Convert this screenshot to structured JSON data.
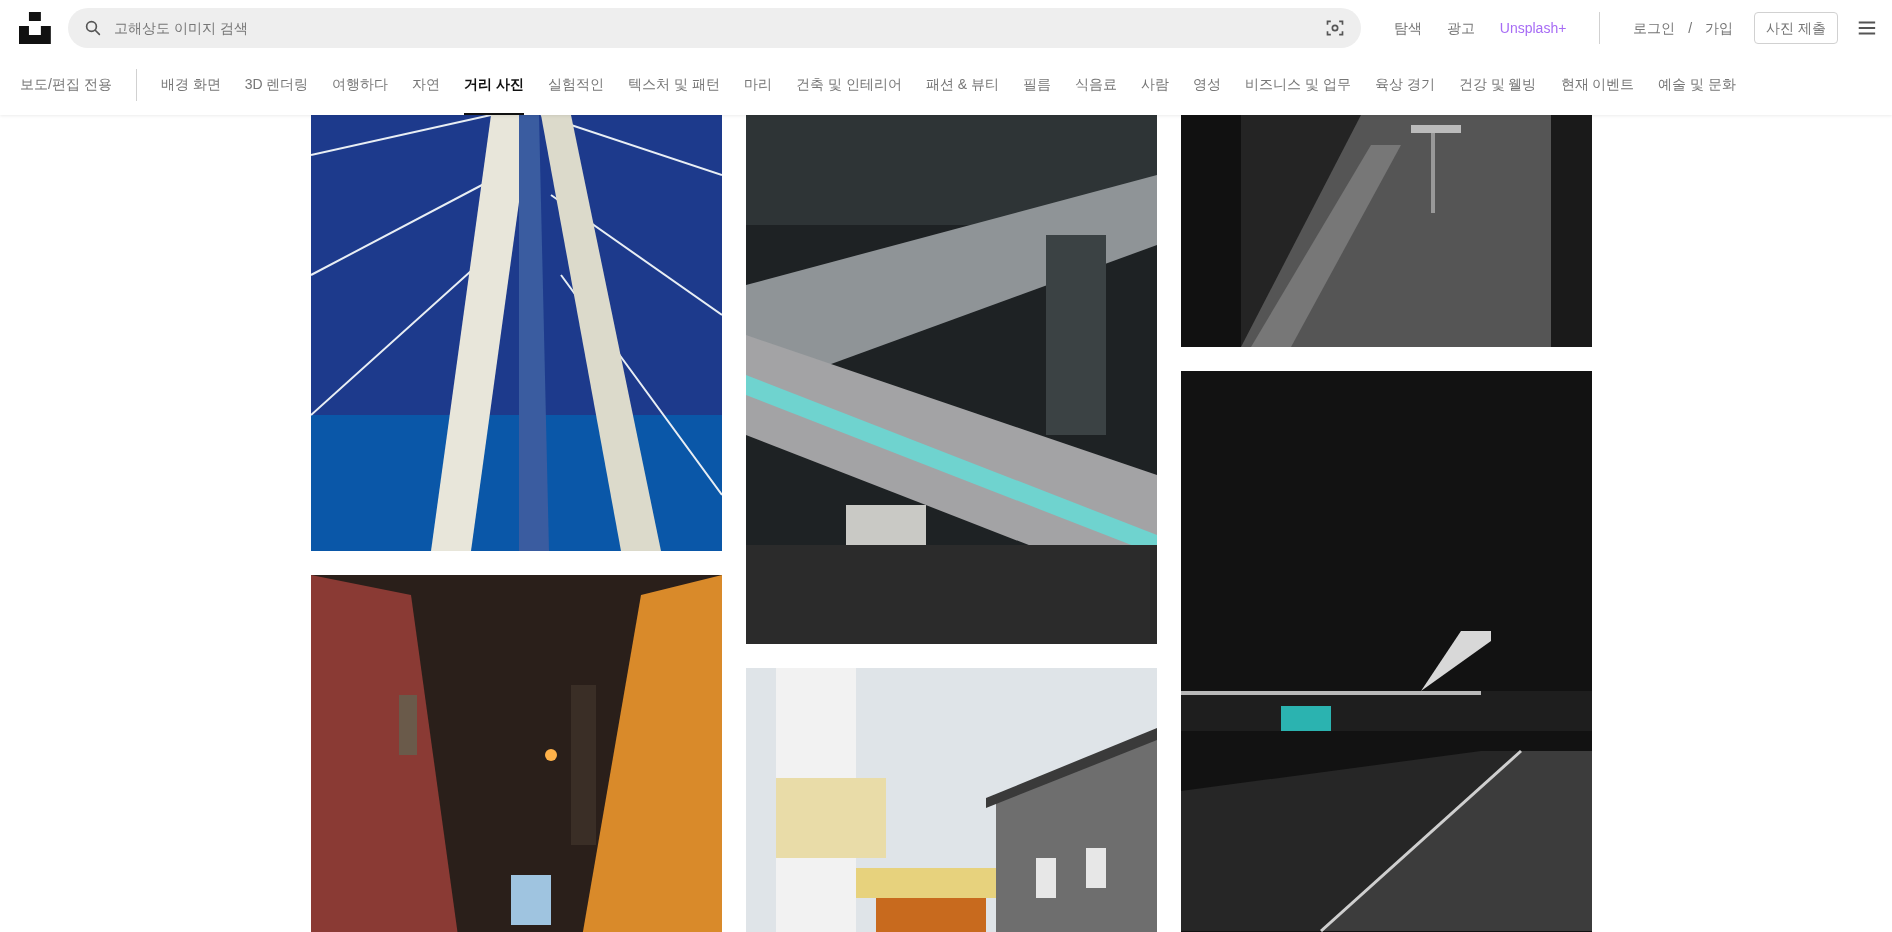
{
  "search": {
    "placeholder": "고해상도 이미지 검색"
  },
  "header_links": [
    {
      "label": "탐색",
      "kind": "plain"
    },
    {
      "label": "광고",
      "kind": "plain"
    },
    {
      "label": "Unsplash+",
      "kind": "accent"
    }
  ],
  "auth": {
    "login": "로그인",
    "separator": "/",
    "signup": "가입"
  },
  "submit_button": "사진 제출",
  "editorial_tab": {
    "label": "보도/편집 전용",
    "selected": false
  },
  "topics": [
    {
      "label": "배경 화면",
      "selected": false
    },
    {
      "label": "3D 렌더링",
      "selected": false
    },
    {
      "label": "여행하다",
      "selected": false
    },
    {
      "label": "자연",
      "selected": false
    },
    {
      "label": "거리 사진",
      "selected": true
    },
    {
      "label": "실험적인",
      "selected": false
    },
    {
      "label": "텍스처 및 패턴",
      "selected": false
    },
    {
      "label": "마리",
      "selected": false
    },
    {
      "label": "건축 및 인테리어",
      "selected": false
    },
    {
      "label": "패션 & 뷰티",
      "selected": false
    },
    {
      "label": "필름",
      "selected": false
    },
    {
      "label": "식음료",
      "selected": false
    },
    {
      "label": "사람",
      "selected": false
    },
    {
      "label": "영성",
      "selected": false
    },
    {
      "label": "비즈니스 및 업무",
      "selected": false
    },
    {
      "label": "육상 경기",
      "selected": false
    },
    {
      "label": "건강 및 웰빙",
      "selected": false
    },
    {
      "label": "현재 이벤트",
      "selected": false
    },
    {
      "label": "예술 및 문화",
      "selected": false
    }
  ]
}
